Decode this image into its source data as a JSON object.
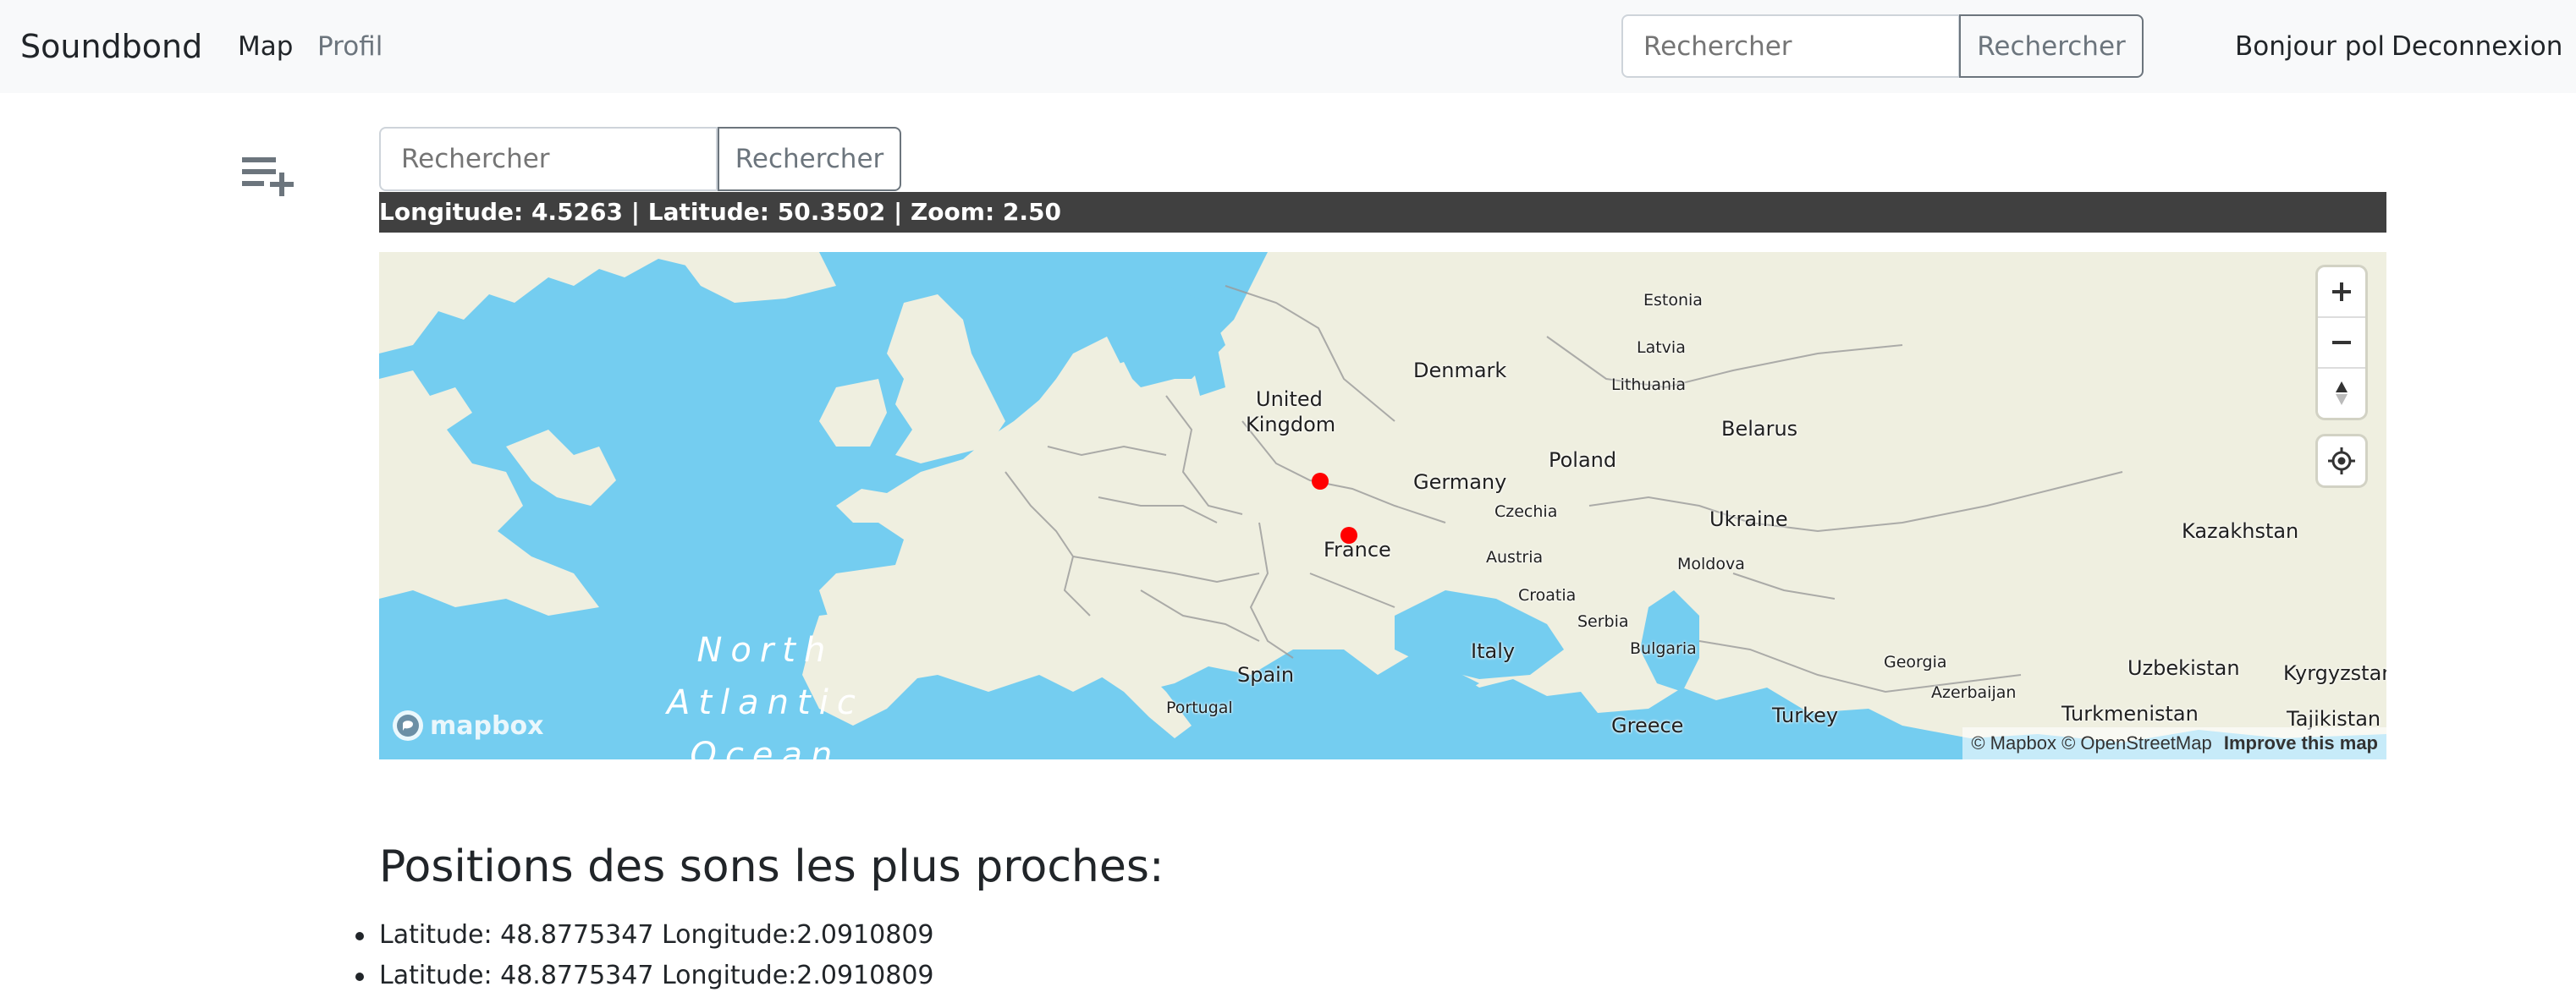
{
  "navbar": {
    "brand": "Soundbond",
    "links": [
      {
        "label": "Map"
      },
      {
        "label": "Profil"
      }
    ],
    "search": {
      "placeholder": "Rechercher",
      "button_label": "Rechercher"
    },
    "greeting": "Bonjour pol",
    "logout_label": "Deconnexion"
  },
  "map_section": {
    "search": {
      "placeholder": "Rechercher",
      "button_label": "Rechercher"
    },
    "coords_text": "Longitude: 4.5263 | Latitude: 50.3502 | Zoom: 2.50",
    "ocean_label": [
      "North",
      "Atlantic",
      "Ocean"
    ],
    "labels": {
      "estonia": "Estonia",
      "latvia": "Latvia",
      "lithuania": "Lithuania",
      "denmark": "Denmark",
      "united_kingdom_1": "United",
      "united_kingdom_2": "Kingdom",
      "belarus": "Belarus",
      "poland": "Poland",
      "germany": "Germany",
      "czechia": "Czechia",
      "ukraine": "Ukraine",
      "france": "France",
      "austria": "Austria",
      "moldova": "Moldova",
      "croatia": "Croatia",
      "serbia": "Serbia",
      "bulgaria": "Bulgaria",
      "italy": "Italy",
      "spain": "Spain",
      "portugal": "Portugal",
      "greece": "Greece",
      "turkey": "Turkey",
      "georgia": "Georgia",
      "azerbaijan": "Azerbaijan",
      "kazakhstan": "Kazakhstan",
      "uzbekistan": "Uzbekistan",
      "kyrgyzstan": "Kyrgyzstan",
      "turkmenistan": "Turkmenistan",
      "tajikistan": "Tajikistan"
    },
    "logo_text": "mapbox",
    "attribution": {
      "mapbox": "© Mapbox",
      "osm": "© OpenStreetMap",
      "improve": "Improve this map"
    },
    "colors": {
      "water": "#74cdf0",
      "land": "#efefe0",
      "marker": "#ff0000",
      "coords_bar": "#404040"
    },
    "controls": [
      "zoom-in",
      "zoom-out",
      "compass",
      "geolocate"
    ]
  },
  "nearest": {
    "title": "Positions des sons les plus proches:",
    "items": [
      {
        "text": "Latitude: 48.8775347 Longitude:2.0910809"
      },
      {
        "text": "Latitude: 48.8775347 Longitude:2.0910809"
      }
    ]
  }
}
